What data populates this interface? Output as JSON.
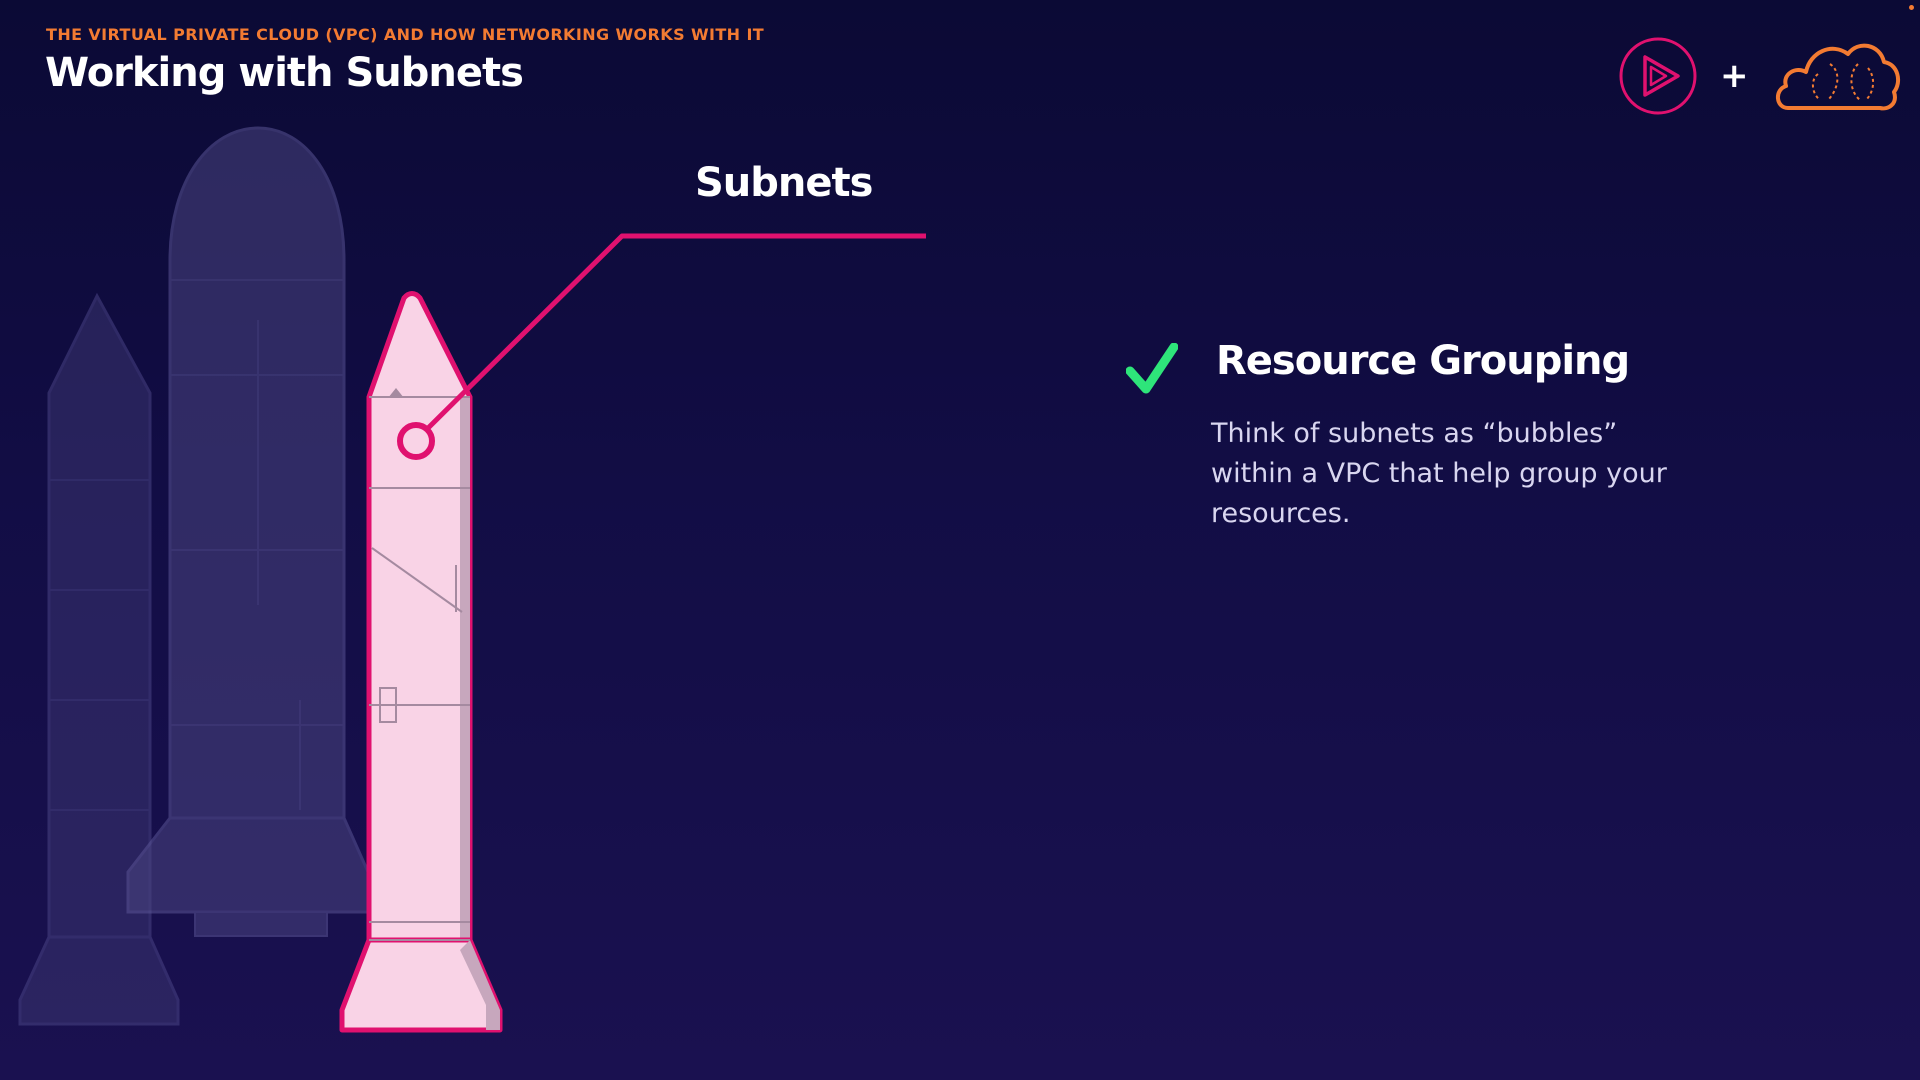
{
  "header": {
    "eyebrow": "THE VIRTUAL PRIVATE CLOUD (VPC) AND HOW NETWORKING WORKS WITH IT",
    "title": "Working with Subnets"
  },
  "logos": {
    "left_icon": "play-icon",
    "plus": "+",
    "right_icon": "cloud-icon"
  },
  "diagram": {
    "callout_label": "Subnets"
  },
  "feature": {
    "icon": "check-icon",
    "title": "Resource Grouping",
    "description": "Think of subnets as “bubbles” within a VPC that help group your resources."
  },
  "colors": {
    "accent_orange": "#f37b32",
    "accent_pink": "#e0116f",
    "check_green": "#2ee57a",
    "rocket_fill": "#f9d3e6"
  }
}
